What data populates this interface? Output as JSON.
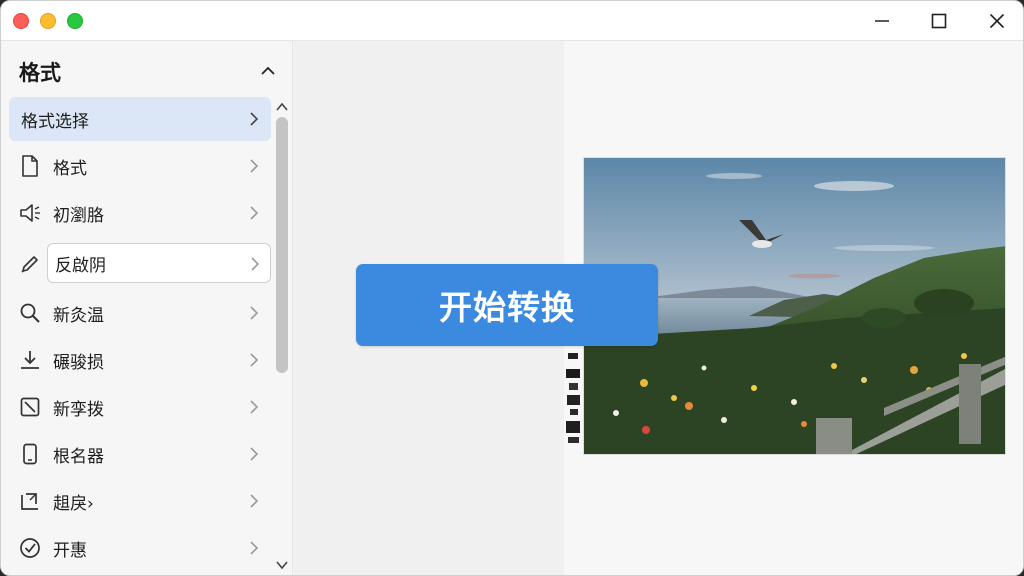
{
  "window": {
    "controls": [
      "close",
      "minimize",
      "zoom"
    ]
  },
  "titlebar": {
    "buttons": [
      "minimize-icon",
      "maximize-icon",
      "close-icon"
    ]
  },
  "sidebar": {
    "title": "格式",
    "items": [
      {
        "label": "格式选择",
        "icon": "none",
        "state": "selected"
      },
      {
        "label": "格式",
        "icon": "document-icon"
      },
      {
        "label": "初瀏胳",
        "icon": "speaker-icon"
      },
      {
        "label": "反啟阴",
        "icon": "pencil-icon",
        "state": "focused"
      },
      {
        "label": "新灸温",
        "icon": "search-icon"
      },
      {
        "label": "碾骏损",
        "icon": "download-icon"
      },
      {
        "label": "新孪拨",
        "icon": "crop-icon"
      },
      {
        "label": "根名器",
        "icon": "phone-icon"
      },
      {
        "label": "趄戾›",
        "icon": "export-icon"
      },
      {
        "label": "开惠",
        "icon": "check-circle-icon"
      }
    ]
  },
  "main": {
    "start_button_label": "开始转换",
    "preview_image": "landscape-photo with seagull, grassy cliff, flowers, wooden fence, sea and sunset sky"
  },
  "colors": {
    "accent": "#3b8ae0",
    "selected_bg": "#dbe7f6"
  }
}
